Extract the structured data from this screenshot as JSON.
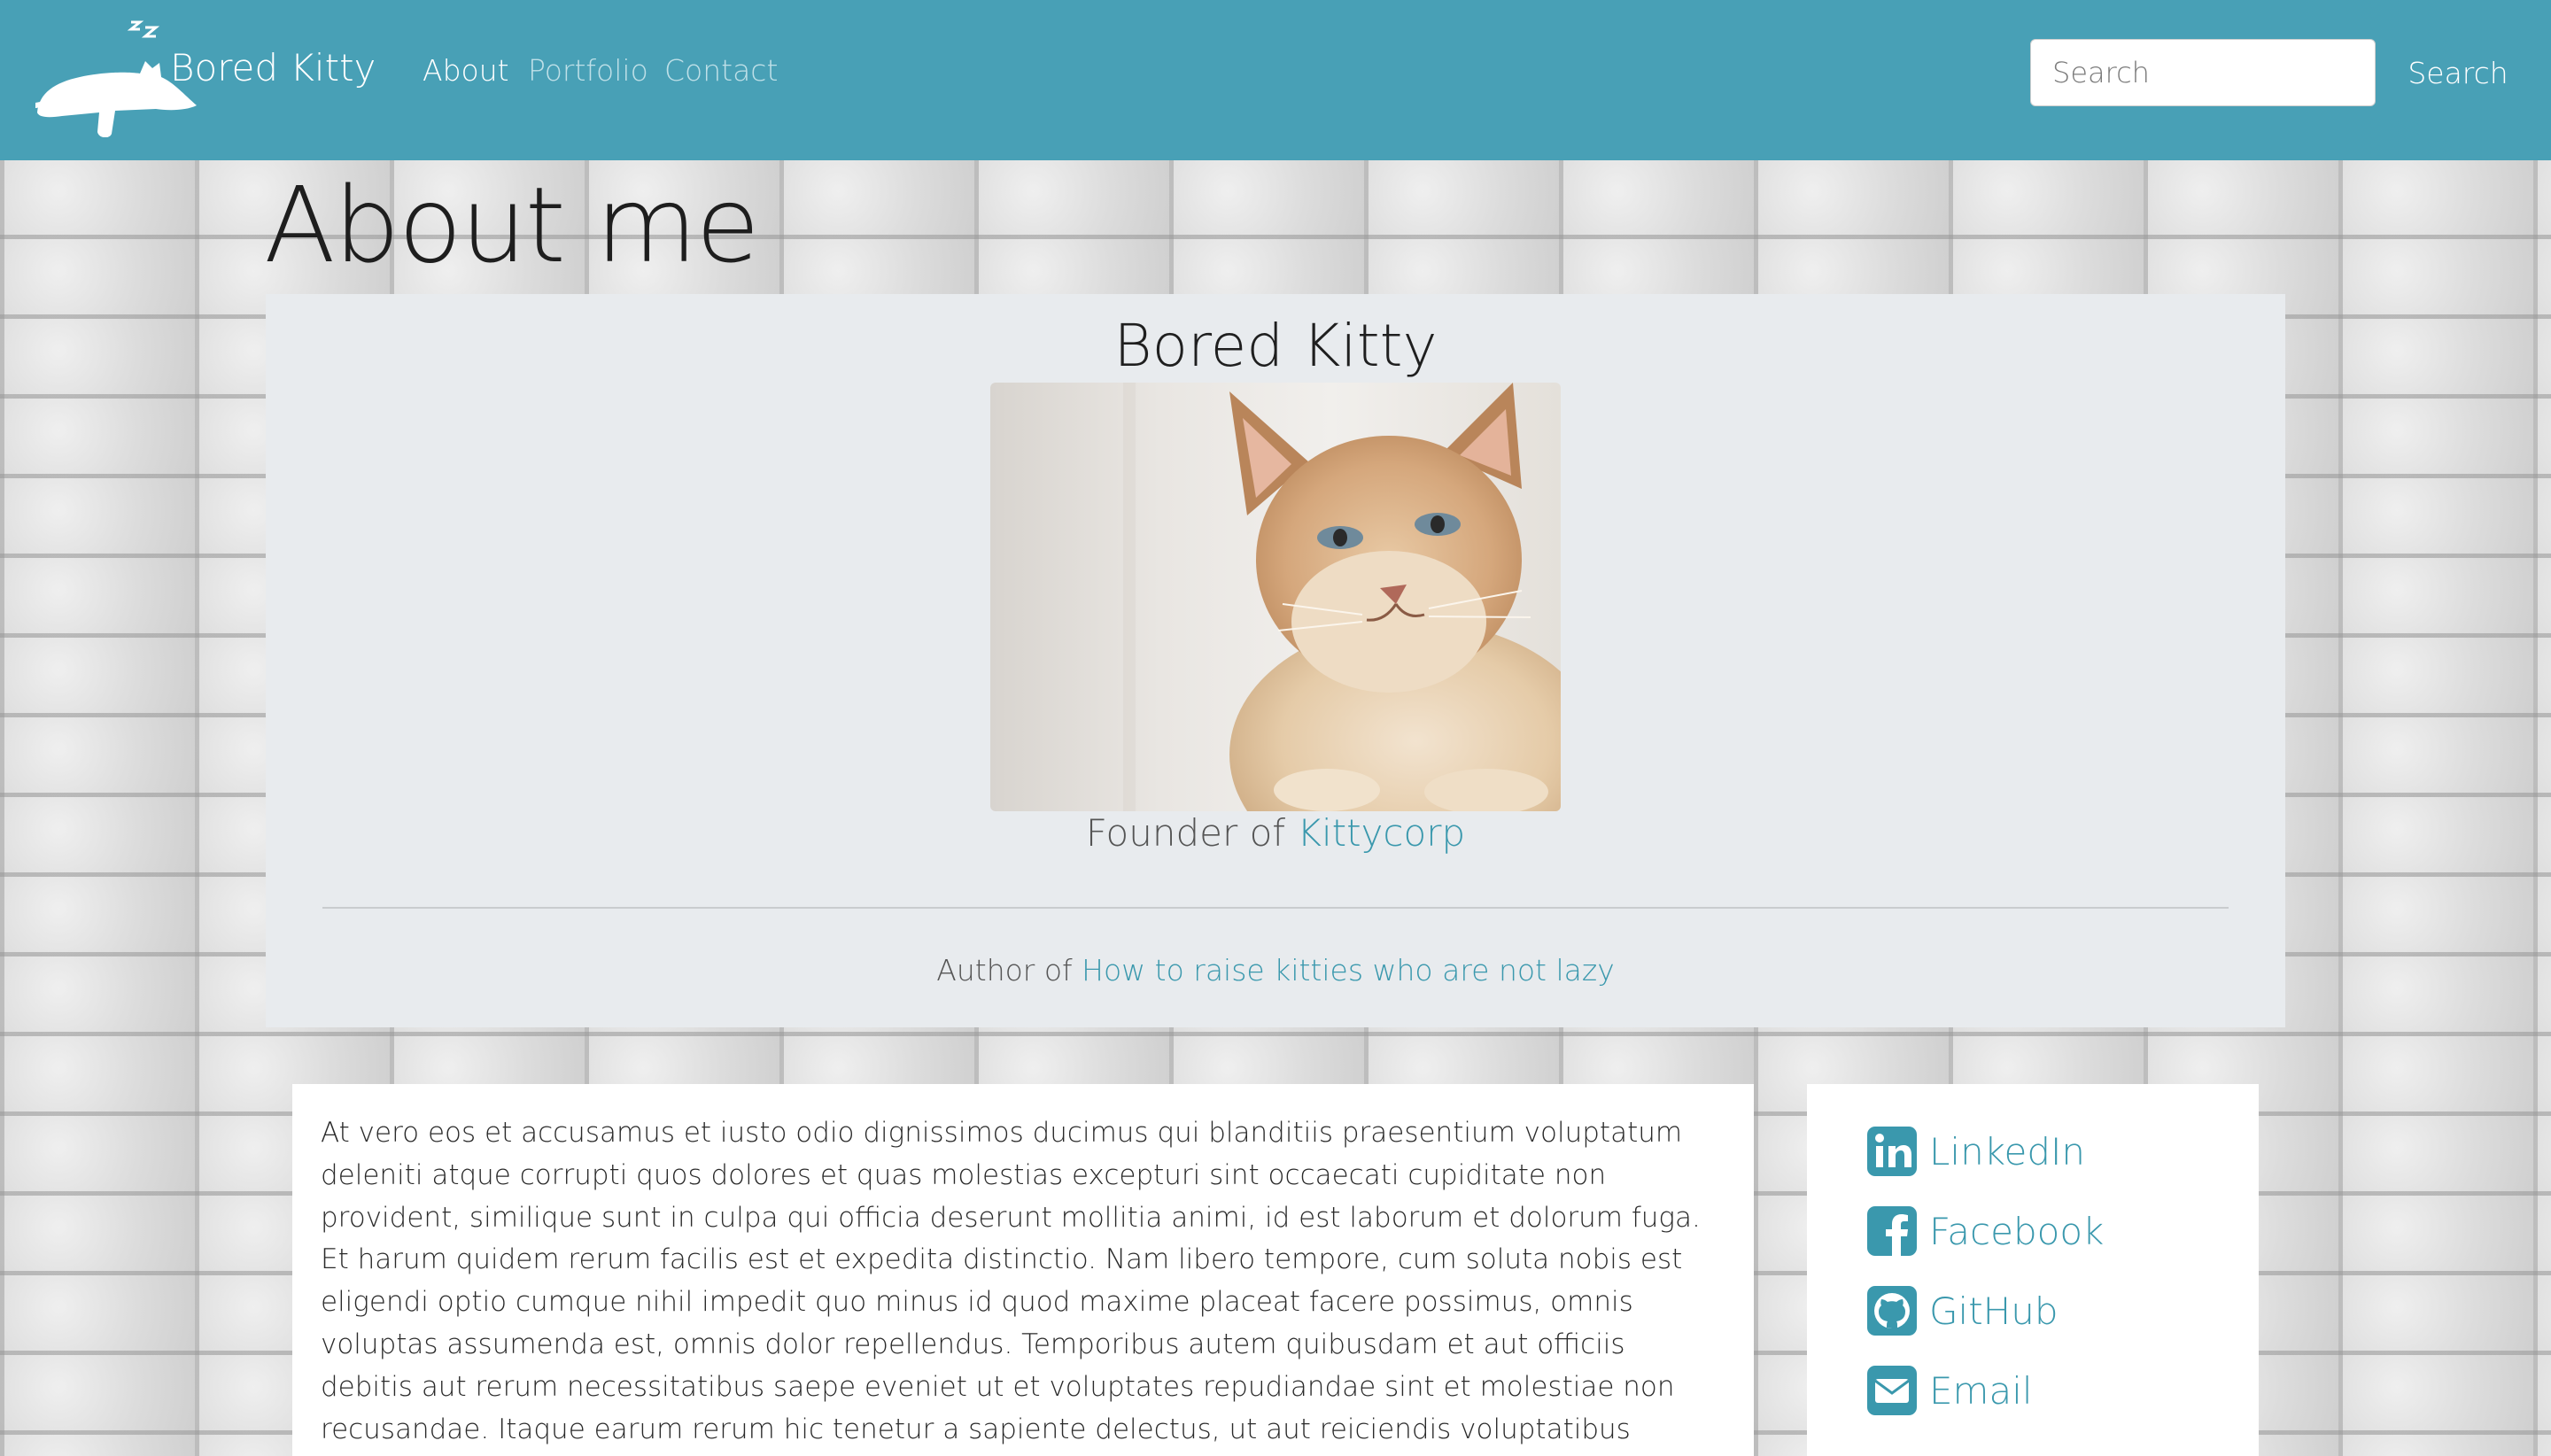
{
  "navbar": {
    "brand": "Bored Kitty",
    "links": [
      {
        "label": "About",
        "active": true
      },
      {
        "label": "Portfolio",
        "active": false
      },
      {
        "label": "Contact",
        "active": false
      }
    ],
    "search_placeholder": "Search",
    "search_button": "Search"
  },
  "page": {
    "title": "About me"
  },
  "profile": {
    "name": "Bored Kitty",
    "founder_prefix": "Founder of ",
    "founder_link": "Kittycorp",
    "author_prefix": "Author of ",
    "author_link": "How to raise kitties who are not lazy"
  },
  "bio": {
    "text": "At vero eos et accusamus et iusto odio dignissimos ducimus qui blanditiis praesentium voluptatum deleniti atque corrupti quos dolores et quas molestias excepturi sint occaecati cupiditate non provident, similique sunt in culpa qui officia deserunt mollitia animi, id est laborum et dolorum fuga. Et harum quidem rerum facilis est et expedita distinctio. Nam libero tempore, cum soluta nobis est eligendi optio cumque nihil impedit quo minus id quod maxime placeat facere possimus, omnis voluptas assumenda est, omnis dolor repellendus. Temporibus autem quibusdam et aut officiis debitis aut rerum necessitatibus saepe eveniet ut et voluptates repudiandae sint et molestiae non recusandae. Itaque earum rerum hic tenetur a sapiente delectus, ut aut reiciendis voluptatibus maiores alias consequatur aut perferendis doloribus asperiores repellat."
  },
  "social": [
    {
      "label": "LinkedIn",
      "icon": "linkedin-icon"
    },
    {
      "label": "Facebook",
      "icon": "facebook-icon"
    },
    {
      "label": "GitHub",
      "icon": "github-icon"
    },
    {
      "label": "Email",
      "icon": "envelope-icon"
    }
  ],
  "colors": {
    "navbar": "#48a0b6",
    "link": "#3a98ad",
    "card": "#e8ebee"
  }
}
